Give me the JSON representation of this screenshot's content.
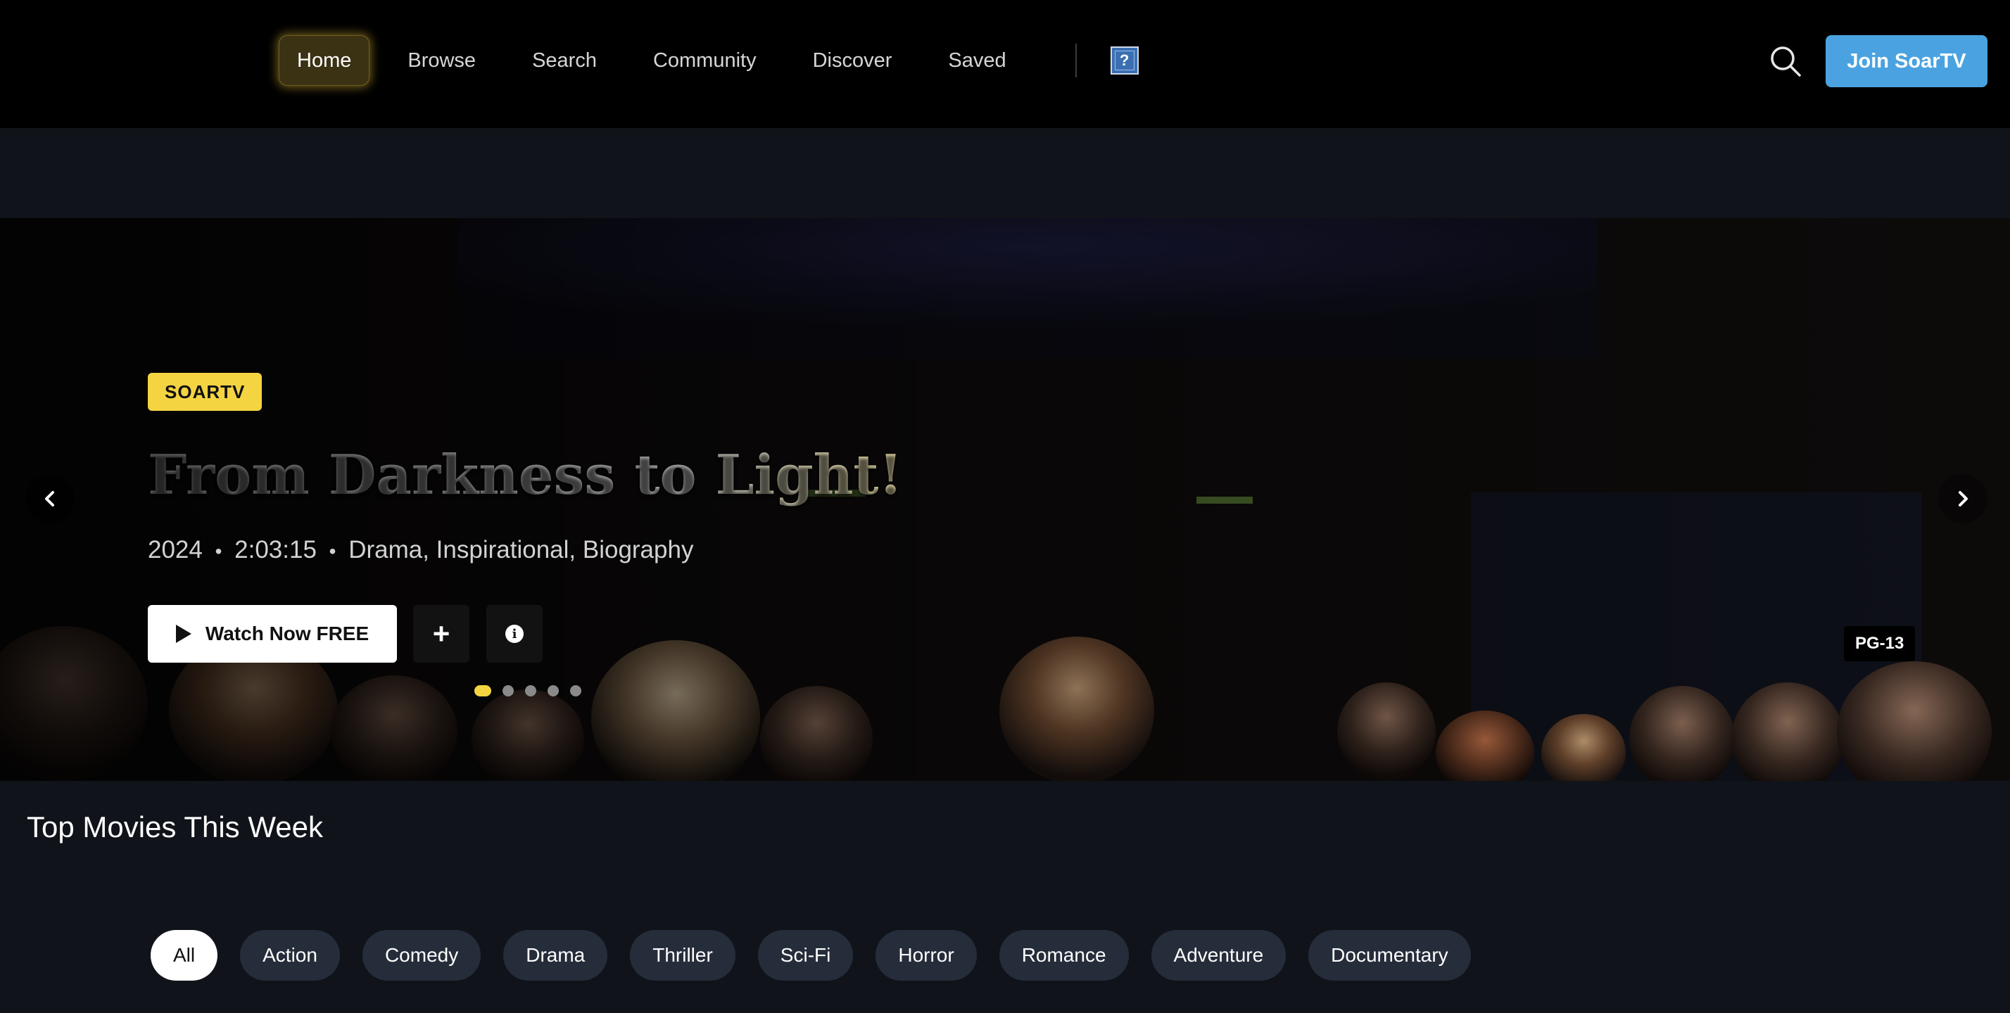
{
  "header": {
    "nav": [
      {
        "label": "Home",
        "active": true
      },
      {
        "label": "Browse"
      },
      {
        "label": "Search"
      },
      {
        "label": "Community"
      },
      {
        "label": "Discover"
      },
      {
        "label": "Saved"
      }
    ],
    "help_icon": "?",
    "search_icon": "search-icon",
    "join_label": "Join SoarTV"
  },
  "hero": {
    "badge": "SOARTV",
    "title": "From Darkness to Light!",
    "year": "2024",
    "duration": "2:03:15",
    "genres": "Drama, Inspirational, Biography",
    "separator": "•",
    "watch_label": "Watch Now FREE",
    "add_icon": "+",
    "info_icon": "i",
    "rating": "PG-13",
    "slides_total": 5,
    "active_slide": 1
  },
  "section": {
    "title": "Top Movies This Week"
  },
  "filters": [
    {
      "label": "All",
      "active": true
    },
    {
      "label": "Action"
    },
    {
      "label": "Comedy"
    },
    {
      "label": "Drama"
    },
    {
      "label": "Thriller"
    },
    {
      "label": "Sci-Fi"
    },
    {
      "label": "Horror"
    },
    {
      "label": "Romance"
    },
    {
      "label": "Adventure"
    },
    {
      "label": "Documentary"
    }
  ],
  "colors": {
    "accent_yellow": "#f5d442",
    "join_blue": "#4aa3e0",
    "background": "#10141a",
    "chip": "#262d3a"
  }
}
